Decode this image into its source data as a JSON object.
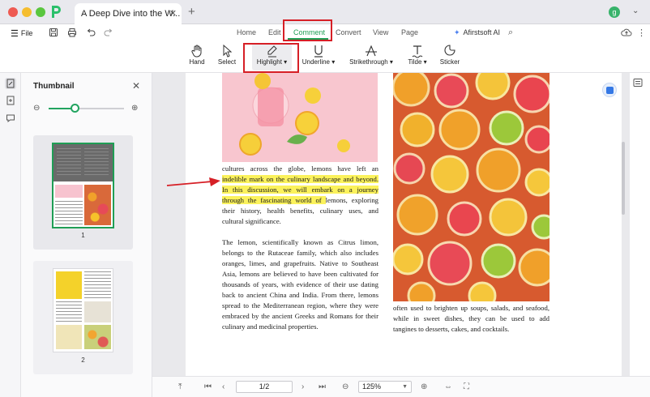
{
  "window": {
    "tab_title": "A Deep Dive into the W...",
    "tab_modified": "*",
    "tab_close": "✕",
    "new_tab": "+",
    "avatar_initial": "g"
  },
  "menu": {
    "file_label": "File",
    "tabs": [
      {
        "label": "Home"
      },
      {
        "label": "Edit"
      },
      {
        "label": "Comment",
        "active": true
      },
      {
        "label": "Convert"
      },
      {
        "label": "View"
      },
      {
        "label": "Page"
      }
    ],
    "ai_label": "Afirstsoft AI"
  },
  "tools": [
    {
      "label": "Hand",
      "icon": "hand-icon"
    },
    {
      "label": "Select",
      "icon": "cursor-icon"
    },
    {
      "label": "Highlight",
      "icon": "highlighter-icon",
      "dropdown": true,
      "selected": true
    },
    {
      "label": "Underline",
      "icon": "underline-icon",
      "dropdown": true
    },
    {
      "label": "Strikethrough",
      "icon": "strikethrough-icon",
      "dropdown": true
    },
    {
      "label": "Tilde",
      "icon": "tilde-icon",
      "dropdown": true
    },
    {
      "label": "Sticker",
      "icon": "sticker-icon"
    }
  ],
  "thumbnail_panel": {
    "title": "Thumbnail",
    "zoom_level": 0.35,
    "pages": [
      {
        "label": "1"
      },
      {
        "label": "2"
      }
    ]
  },
  "document": {
    "col1_first_line": "cultures across the globe, lemons have left an",
    "col1_hl_line1": "indelible mark on the culinary landscape and beyond.",
    "col1_hl_line2": "In this discussion, we will embark on a journey",
    "col1_hl_line3_hl": "through the fascinating world of ",
    "col1_hl_line3_rest": "lemons, exploring",
    "col1_line5": "their history, health benefits, culinary uses, and",
    "col1_line6": "cultural significance.",
    "col1_para2": [
      "The lemon, scientifically known as Citrus limon,",
      "belongs to the Rutaceae family, which also includes",
      "oranges, limes, and grapefruits. Native to Southeast",
      "Asia, lemons are believed to have been cultivated for",
      "thousands of years, with evidence of their use dating",
      "back to ancient China and India. From there, lemons",
      "spread to the Mediterranean region, where they were",
      "embraced by the ancient Greeks and Romans for their",
      "culinary and medicinal properties."
    ],
    "col2_text": [
      "often used to brighten up soups, salads, and seafood,",
      "while in sweet dishes, they can be used to add",
      "tangines to desserts, cakes, and cocktails."
    ]
  },
  "bottom_bar": {
    "page_value": "1/2",
    "zoom_value": "125%"
  },
  "colors": {
    "accent": "#1f9e55",
    "highlight": "#fbf25c",
    "annotation_red": "#d61f26"
  }
}
